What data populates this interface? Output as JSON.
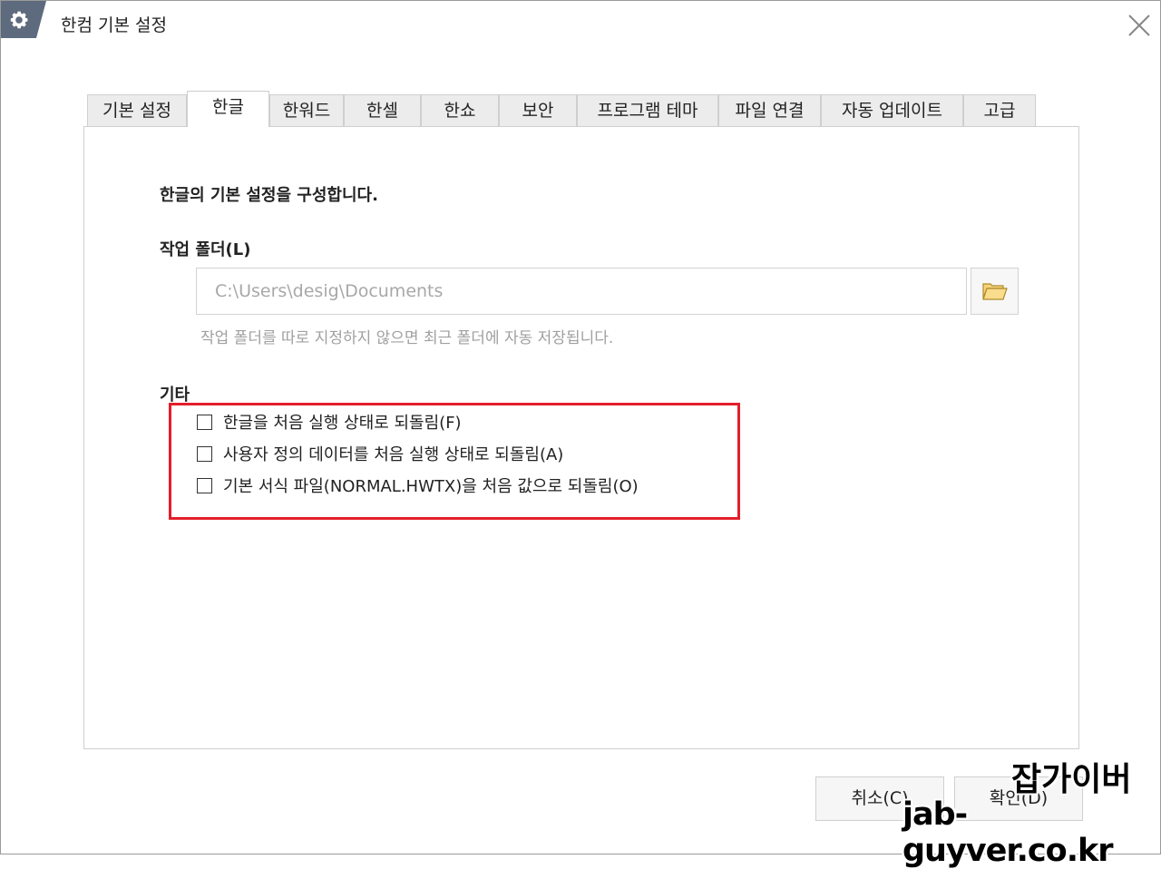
{
  "window": {
    "title": "한컴 기본 설정",
    "icon": "gear-icon",
    "close_icon": "close-icon"
  },
  "tabs": [
    {
      "label": "기본 설정",
      "active": false
    },
    {
      "label": "한글",
      "active": true
    },
    {
      "label": "한워드",
      "active": false
    },
    {
      "label": "한셀",
      "active": false
    },
    {
      "label": "한쇼",
      "active": false
    },
    {
      "label": "보안",
      "active": false
    },
    {
      "label": "프로그램 테마",
      "active": false
    },
    {
      "label": "파일 연결",
      "active": false
    },
    {
      "label": "자동 업데이트",
      "active": false
    },
    {
      "label": "고급",
      "active": false
    }
  ],
  "content": {
    "description": "한글의 기본 설정을 구성합니다.",
    "work_folder": {
      "label": "작업 폴더(L)",
      "value": "C:\\Users\\desig\\Documents",
      "browse_icon": "folder-open-icon",
      "hint": "작업 폴더를 따로 지정하지 않으면 최근 폴더에 자동 저장됩니다."
    },
    "etc": {
      "label": "기타",
      "checkboxes": [
        {
          "label": "한글을 처음 실행 상태로 되돌림(F)",
          "checked": false
        },
        {
          "label": "사용자 정의 데이터를 처음 실행 상태로 되돌림(A)",
          "checked": false
        },
        {
          "label": "기본 서식 파일(NORMAL.HWTX)을 처음 값으로 되돌림(O)",
          "checked": false
        }
      ],
      "highlight_color": "#e41e2b"
    }
  },
  "buttons": {
    "cancel": "취소(C)",
    "ok": "확인(D)"
  },
  "watermark": {
    "line1": "잡가이버",
    "line2": "jab-guyver.co.kr"
  }
}
